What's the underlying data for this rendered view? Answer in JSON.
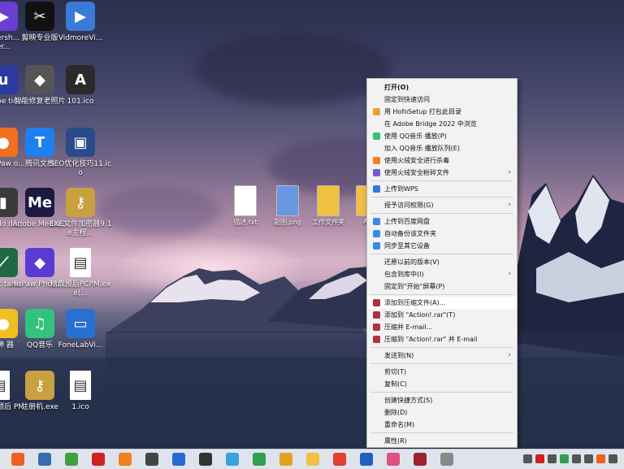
{
  "desktop": {
    "icons_col0": [
      {
        "label": "ersh... iver...",
        "color": "#6a3fd0",
        "glyph": "▶"
      },
      {
        "label": "be tion",
        "color": "#2c3aa0",
        "glyph": "u"
      },
      {
        "label": "Paw o...",
        "color": "#f07020",
        "glyph": "●"
      },
      {
        "label": "do der",
        "color": "#3a3a3a",
        "glyph": "▮"
      },
      {
        "label": "it taller",
        "color": "#1f6a44",
        "glyph": "⟋"
      },
      {
        "label": "神 器",
        "color": "#f0c020",
        "glyph": "●"
      },
      {
        "label": "预后 PM",
        "color": "#ffffff",
        "glyph": "▤"
      }
    ],
    "icons_col1": [
      {
        "label": "剪映专业版",
        "color": "#111111",
        "glyph": "✂"
      },
      {
        "label": "智能修复老照片",
        "color": "#555555",
        "glyph": "◆"
      },
      {
        "label": "腾讯文档",
        "color": "#1e7ff0",
        "glyph": "T"
      },
      {
        "label": "Adobe Media...",
        "color": "#1c1a40",
        "glyph": "Me"
      },
      {
        "label": "HitPaw Photo ...",
        "color": "#5a3ad0",
        "glyph": "◆"
      },
      {
        "label": "QQ音乐",
        "color": "#31c27c",
        "glyph": "♫"
      },
      {
        "label": "注册机.exe",
        "color": "#c8a040",
        "glyph": "⚷"
      }
    ],
    "icons_col2": [
      {
        "label": "VidmoreVi...",
        "color": "#3b7bd8",
        "glyph": "▶"
      },
      {
        "label": "101.ico",
        "color": "#2a2a2a",
        "glyph": "A"
      },
      {
        "label": "SEO优化技巧11.ico",
        "color": "#2a4a8a",
        "glyph": "▣"
      },
      {
        "label": "EXE文件加密器9.1e主程...",
        "color": "#c8a040",
        "glyph": "⚷"
      },
      {
        "label": "精鼎预后PCPM.exe(...",
        "color": "#ffffff",
        "glyph": "▤"
      },
      {
        "label": "FoneLabVi...",
        "color": "#2a70d0",
        "glyph": "▭"
      },
      {
        "label": "1.ico",
        "color": "#ffffff",
        "glyph": "▤"
      }
    ],
    "center_files": [
      {
        "label": "描述.txt",
        "color": "#ffffff"
      },
      {
        "label": "副图.png",
        "color": "#6a98e0"
      },
      {
        "label": "工作文件夹",
        "color": "#f0c040"
      },
      {
        "label": "Ac",
        "color": "#f0c040"
      }
    ]
  },
  "context_menu": {
    "items": [
      {
        "label": "打开(O)",
        "bold": true,
        "icon": "",
        "arrow": false
      },
      {
        "label": "固定到快速访问",
        "icon": "",
        "arrow": false
      },
      {
        "label": "用 HofoSetup 打包此目录",
        "icon": "#f0a030",
        "arrow": false
      },
      {
        "label": "在 Adobe Bridge 2022 中浏览",
        "icon": "",
        "arrow": false
      },
      {
        "label": "使用 QQ音乐 播放(P)",
        "icon": "#31c27c",
        "arrow": false
      },
      {
        "label": "加入 QQ音乐 播放队列(E)",
        "icon": "",
        "arrow": false
      },
      {
        "label": "使用火绒安全进行杀毒",
        "icon": "#f08020",
        "arrow": false
      },
      {
        "label": "使用火绒安全粉碎文件",
        "icon": "#7a5ad0",
        "arrow": true
      },
      {
        "sep": true
      },
      {
        "label": "上传到WPS",
        "icon": "#2a7ae0",
        "arrow": false
      },
      {
        "sep": true
      },
      {
        "label": "授予访问权限(G)",
        "icon": "",
        "arrow": true
      },
      {
        "sep": true
      },
      {
        "label": "上传到百度网盘",
        "icon": "#3a8ae8",
        "arrow": false
      },
      {
        "label": "自动备份该文件夹",
        "icon": "#3a8ae8",
        "arrow": false
      },
      {
        "label": "同步至其它设备",
        "icon": "#3a8ae8",
        "arrow": false
      },
      {
        "sep": true
      },
      {
        "label": "还原以前的版本(V)",
        "icon": "",
        "arrow": false
      },
      {
        "label": "包含到库中(I)",
        "icon": "",
        "arrow": true
      },
      {
        "label": "固定到\"开始\"屏幕(P)",
        "icon": "",
        "arrow": false
      },
      {
        "sep": true
      },
      {
        "label": "添加到压缩文件(A)...",
        "icon": "#b03040",
        "arrow": false,
        "highlight": true
      },
      {
        "label": "添加到 \"Action!.rar\"(T)",
        "icon": "#b03040",
        "arrow": false
      },
      {
        "label": "压缩并 E-mail...",
        "icon": "#b03040",
        "arrow": false
      },
      {
        "label": "压缩到 \"Action!.rar\" 并 E-mail",
        "icon": "#b03040",
        "arrow": false
      },
      {
        "sep": true
      },
      {
        "label": "发送到(N)",
        "icon": "",
        "arrow": true
      },
      {
        "sep": true
      },
      {
        "label": "剪切(T)",
        "icon": "",
        "arrow": false
      },
      {
        "label": "复制(C)",
        "icon": "",
        "arrow": false
      },
      {
        "sep": true
      },
      {
        "label": "创建快捷方式(S)",
        "icon": "",
        "arrow": false
      },
      {
        "label": "删除(D)",
        "icon": "",
        "arrow": false
      },
      {
        "label": "重命名(M)",
        "icon": "",
        "arrow": false
      },
      {
        "sep": true
      },
      {
        "label": "属性(R)",
        "icon": "",
        "arrow": false
      }
    ]
  },
  "taskbar": {
    "apps": [
      {
        "name": "app-orange",
        "color": "#f06020"
      },
      {
        "name": "app-printer",
        "color": "#3a6ab0"
      },
      {
        "name": "app-green-arrow",
        "color": "#40a040"
      },
      {
        "name": "app-record",
        "color": "#d02020"
      },
      {
        "name": "app-search",
        "color": "#f08020"
      },
      {
        "name": "app-aperture",
        "color": "#444444"
      },
      {
        "name": "app-blue-circle",
        "color": "#2a6ad0"
      },
      {
        "name": "app-a-circle",
        "color": "#333333"
      },
      {
        "name": "app-bird",
        "color": "#3aa0e0"
      },
      {
        "name": "app-panda",
        "color": "#30a050"
      },
      {
        "name": "app-box",
        "color": "#e0a020"
      },
      {
        "name": "app-folder",
        "color": "#f0c040"
      },
      {
        "name": "app-chrome",
        "color": "#e04030"
      },
      {
        "name": "app-blue-square",
        "color": "#2060c0"
      },
      {
        "name": "app-colorful",
        "color": "#e05080"
      },
      {
        "name": "app-rar",
        "color": "#a02030"
      },
      {
        "name": "app-gray",
        "color": "#888888"
      }
    ],
    "tray": [
      {
        "name": "chevron-up-icon",
        "color": "#555555"
      },
      {
        "name": "record-icon",
        "color": "#d02020"
      },
      {
        "name": "mic-icon",
        "color": "#555555"
      },
      {
        "name": "sync-icon",
        "color": "#30a050"
      },
      {
        "name": "check-icon",
        "color": "#555555"
      },
      {
        "name": "network-icon",
        "color": "#555555"
      },
      {
        "name": "app-tray-orange",
        "color": "#f06020"
      },
      {
        "name": "volume-icon",
        "color": "#555555"
      }
    ]
  }
}
